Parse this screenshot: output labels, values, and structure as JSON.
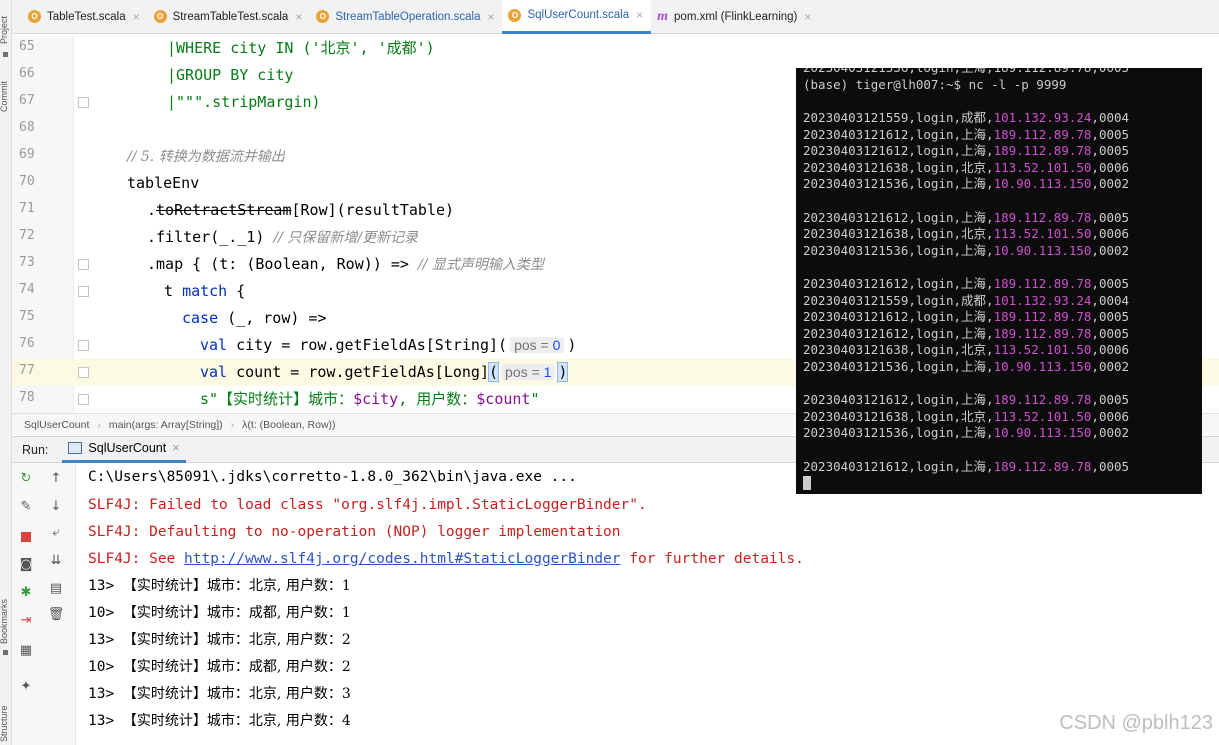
{
  "sidebar_labels": [
    "Project",
    "Commit",
    "Bookmarks",
    "Structure"
  ],
  "tabs": [
    {
      "name": "TableTest.scala",
      "icon": "scala-object-icon",
      "active": false,
      "blue": false
    },
    {
      "name": "StreamTableTest.scala",
      "icon": "scala-object-icon",
      "active": false,
      "blue": false
    },
    {
      "name": "StreamTableOperation.scala",
      "icon": "scala-object-icon",
      "active": false,
      "blue": true
    },
    {
      "name": "SqlUserCount.scala",
      "icon": "scala-object-icon",
      "active": true,
      "blue": true
    },
    {
      "name": "pom.xml (FlinkLearning)",
      "icon": "maven-icon",
      "active": false,
      "blue": false
    }
  ],
  "tab_close_glyph": "×",
  "maven_glyph": "m",
  "scala_glyph": "O",
  "editor": {
    "line_numbers": [
      "65",
      "66",
      "67",
      "68",
      "69",
      "70",
      "71",
      "72",
      "73",
      "74",
      "75",
      "76",
      "77",
      "78"
    ],
    "code": {
      "l65": "|WHERE city IN ('北京', '成都')",
      "l66": "|GROUP BY city",
      "l67": "|\"\"\".stripMargin)",
      "l69": "// 5. 转换为数据流并输出",
      "l70": "tableEnv",
      "l71_a": ".",
      "l71_b": "toRetractStream",
      "l71_c": "[Row](resultTable)",
      "l72_a": ".filter(_._1) ",
      "l72_b": "// 只保留新增/更新记录",
      "l73_a": ".map { (t: (Boolean, Row)) => ",
      "l73_b": "// 显式声明输入类型",
      "l74_a": "t ",
      "l74_b": "match",
      "l74_c": " {",
      "l75_a": "case",
      "l75_b": " (_, row) =>",
      "l76_a": "val",
      "l76_b": " city = row.getFieldAs[String](",
      "l76_hint": "pos = ",
      "l76_num": "0",
      "l76_c": ")",
      "l77_a": "val",
      "l77_b": " count = row.getFieldAs[Long]",
      "l77_open": "(",
      "l77_hint": "pos = ",
      "l77_num": "1",
      "l77_close": ")",
      "l78_a": "s\"【实时统计】城市：",
      "l78_b": "$city",
      "l78_c": ", 用户数：",
      "l78_d": "$count",
      "l78_e": "\""
    }
  },
  "breadcrumb": [
    "SqlUserCount",
    "main(args: Array[String])",
    "λ(t: (Boolean, Row))"
  ],
  "breadcrumb_sep": "›",
  "run": {
    "label": "Run:",
    "tab": "SqlUserCount",
    "close": "×"
  },
  "console": {
    "cmd": "C:\\Users\\85091\\.jdks\\corretto-1.8.0_362\\bin\\java.exe ...",
    "err1": "SLF4J: Failed to load class \"org.slf4j.impl.StaticLoggerBinder\".",
    "err2": "SLF4J: Defaulting to no-operation (NOP) logger implementation",
    "err3_a": "SLF4J: See ",
    "err3_link": "http://www.slf4j.org/codes.html#StaticLoggerBinder",
    "err3_b": " for further details.",
    "outputs": [
      {
        "prefix": "13> ",
        "text": "【实时统计】城市：北京, 用户数：1"
      },
      {
        "prefix": "10> ",
        "text": "【实时统计】城市：成都, 用户数：1"
      },
      {
        "prefix": "13> ",
        "text": "【实时统计】城市：北京, 用户数：2"
      },
      {
        "prefix": "10> ",
        "text": "【实时统计】城市：成都, 用户数：2"
      },
      {
        "prefix": "13> ",
        "text": "【实时统计】城市：北京, 用户数：3"
      },
      {
        "prefix": "13> ",
        "text": "【实时统计】城市：北京, 用户数：4"
      }
    ]
  },
  "terminal": {
    "top_partial": "20230403121536,login,上海,189.112.89.78,0005",
    "prompt": "(base) tiger@lh007:~$ nc -l -p 9999",
    "lines": [
      {
        "p": "20230403121559,login,成都,",
        "ip": "101.132.93.24",
        "s": ",0004"
      },
      {
        "p": "20230403121612,login,上海,",
        "ip": "189.112.89.78",
        "s": ",0005"
      },
      {
        "p": "20230403121612,login,上海,",
        "ip": "189.112.89.78",
        "s": ",0005"
      },
      {
        "p": "20230403121638,login,北京,",
        "ip": "113.52.101.50",
        "s": ",0006"
      },
      {
        "p": "20230403121536,login,上海,",
        "ip": "10.90.113.150",
        "s": ",0002"
      },
      null,
      {
        "p": "20230403121612,login,上海,",
        "ip": "189.112.89.78",
        "s": ",0005"
      },
      {
        "p": "20230403121638,login,北京,",
        "ip": "113.52.101.50",
        "s": ",0006"
      },
      {
        "p": "20230403121536,login,上海,",
        "ip": "10.90.113.150",
        "s": ",0002"
      },
      null,
      {
        "p": "20230403121612,login,上海,",
        "ip": "189.112.89.78",
        "s": ",0005"
      },
      {
        "p": "20230403121559,login,成都,",
        "ip": "101.132.93.24",
        "s": ",0004"
      },
      {
        "p": "20230403121612,login,上海,",
        "ip": "189.112.89.78",
        "s": ",0005"
      },
      {
        "p": "20230403121612,login,上海,",
        "ip": "189.112.89.78",
        "s": ",0005"
      },
      {
        "p": "20230403121638,login,北京,",
        "ip": "113.52.101.50",
        "s": ",0006"
      },
      {
        "p": "20230403121536,login,上海,",
        "ip": "10.90.113.150",
        "s": ",0002"
      },
      null,
      {
        "p": "20230403121612,login,上海,",
        "ip": "189.112.89.78",
        "s": ",0005"
      },
      {
        "p": "20230403121638,login,北京,",
        "ip": "113.52.101.50",
        "s": ",0006"
      },
      {
        "p": "20230403121536,login,上海,",
        "ip": "10.90.113.150",
        "s": ",0002"
      },
      null,
      {
        "p": "20230403121612,login,上海,",
        "ip": "189.112.89.78",
        "s": ",0005"
      }
    ]
  },
  "watermark": "CSDN @pblh123",
  "colors": {
    "accent": "#4083c9",
    "terminal_bg": "#0c0c0c",
    "ip_magenta": "#d04fd0",
    "error_red": "#c7211f",
    "keyword_blue": "#0033b3",
    "string_green": "#067d17"
  }
}
